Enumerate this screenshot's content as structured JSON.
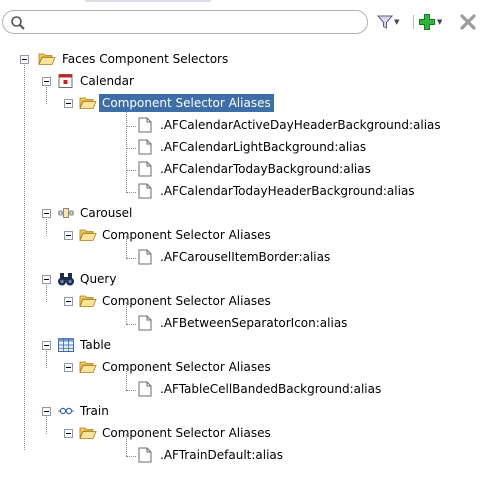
{
  "search": {
    "value": "",
    "placeholder": ""
  },
  "toolbar": {
    "filter_icon": "filter-funnel-icon",
    "add_icon": "add-plus-icon",
    "close_icon": "close-x-icon"
  },
  "tree": {
    "root": {
      "label": "Faces Component Selectors",
      "icon": "folder-open-icon",
      "children": [
        {
          "label": "Calendar",
          "icon": "calendar-icon",
          "aliases_label": "Component Selector Aliases",
          "selected": true,
          "items": [
            ".AFCalendarActiveDayHeaderBackground:alias",
            ".AFCalendarLightBackground:alias",
            ".AFCalendarTodayBackground:alias",
            ".AFCalendarTodayHeaderBackground:alias"
          ]
        },
        {
          "label": "Carousel",
          "icon": "carousel-icon",
          "aliases_label": "Component Selector Aliases",
          "items": [
            ".AFCarouselItemBorder:alias"
          ]
        },
        {
          "label": "Query",
          "icon": "binoculars-icon",
          "aliases_label": "Component Selector Aliases",
          "items": [
            ".AFBetweenSeparatorIcon:alias"
          ]
        },
        {
          "label": "Table",
          "icon": "table-icon",
          "aliases_label": "Component Selector Aliases",
          "items": [
            ".AFTableCellBandedBackground:alias"
          ]
        },
        {
          "label": "Train",
          "icon": "train-icon",
          "aliases_label": "Component Selector Aliases",
          "items": [
            ".AFTrainDefault:alias"
          ]
        }
      ]
    }
  },
  "colors": {
    "selection": "#3d6ea8",
    "folder": "#e7b83e",
    "calendar_red": "#c8201e",
    "add_green": "#1f9d2e"
  }
}
